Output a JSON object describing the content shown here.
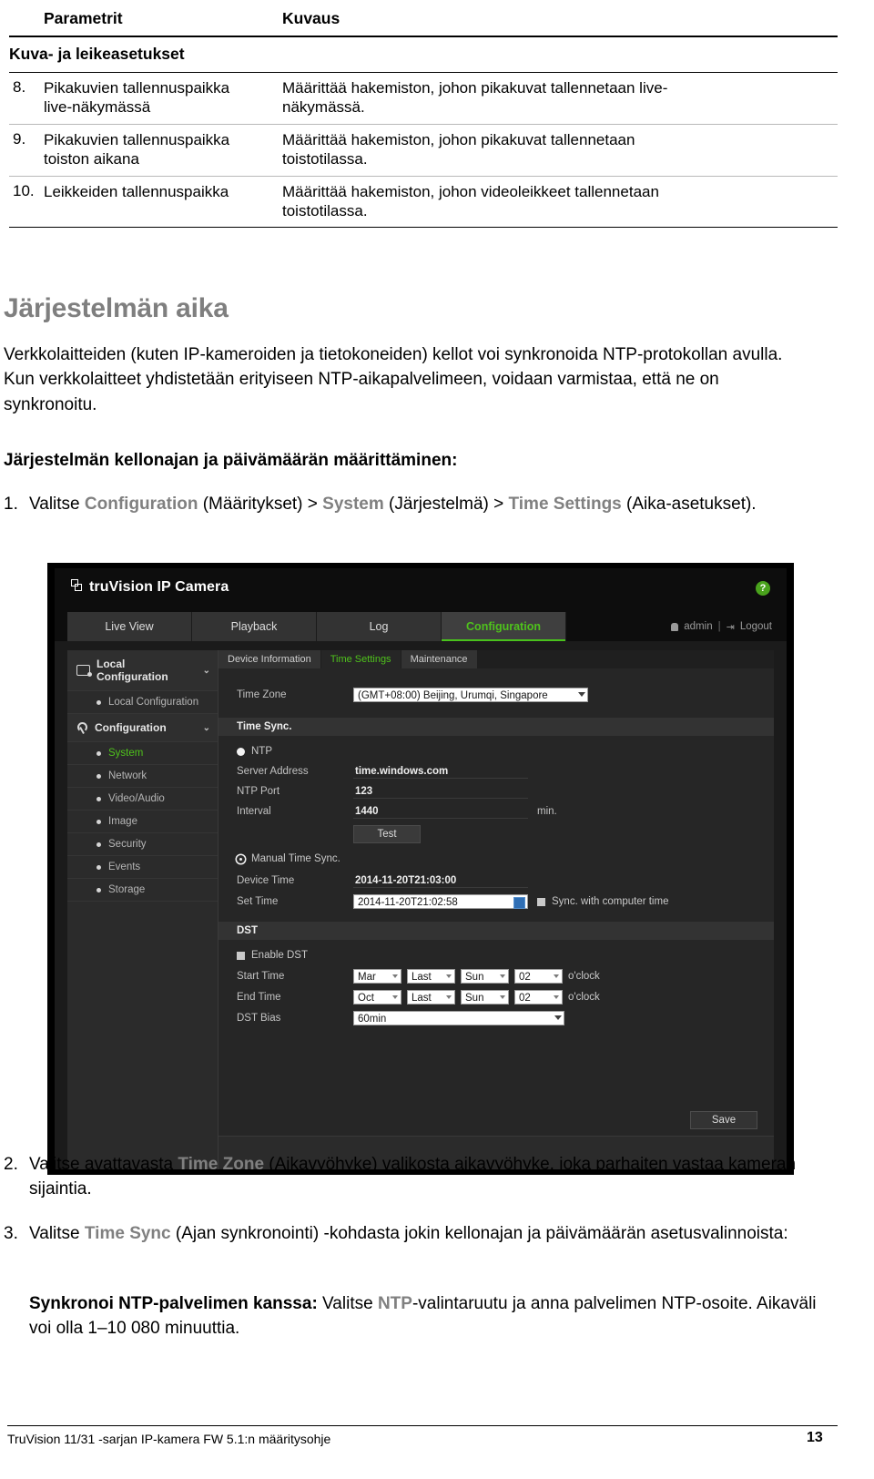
{
  "table": {
    "headers": [
      "Parametrit",
      "Kuvaus"
    ],
    "section_title": "Kuva- ja leikeasetukset",
    "rows": [
      {
        "num": "8.",
        "param_lines": [
          "Pikakuvien tallennuspaikka",
          "live-näkymässä"
        ],
        "desc_lines": [
          "Määrittää hakemiston, johon pikakuvat tallennetaan live-",
          "näkymässä."
        ]
      },
      {
        "num": "9.",
        "param_lines": [
          "Pikakuvien tallennuspaikka",
          "toiston aikana"
        ],
        "desc_lines": [
          "Määrittää hakemiston, johon pikakuvat tallennetaan",
          "toistotilassa."
        ]
      },
      {
        "num": "10.",
        "param_lines": [
          "Leikkeiden tallennuspaikka"
        ],
        "desc_lines": [
          "Määrittää hakemiston, johon videoleikkeet tallennetaan",
          "toistotilassa."
        ]
      }
    ]
  },
  "heading": "Järjestelmän aika",
  "intro_paragraph": "Verkkolaitteiden (kuten IP-kameroiden ja tietokoneiden) kellot voi synkronoida NTP-protokollan avulla. Kun verkkolaitteet yhdistetään erityiseen NTP-aikapalvelimeen, voidaan varmistaa, että ne on synkronoitu.",
  "sub_heading": "Järjestelmän kellonajan ja päivämäärän määrittäminen:",
  "steps": {
    "step1": {
      "num": "1.",
      "t1": "Valitse ",
      "ui1": "Configuration",
      "t2": " (Määritykset) > ",
      "ui2": "System",
      "t3": " (Järjestelmä) > ",
      "ui3": "Time Settings",
      "t4": " (Aika-asetukset)."
    },
    "step2": {
      "num": "2.",
      "t1": "Valitse avattavasta ",
      "ui1": "Time Zone",
      "t2": " (Aikavyöhyke) valikosta aikavyöhyke, joka parhaiten vastaa kameran sijaintia."
    },
    "step3": {
      "num": "3.",
      "t1": "Valitse ",
      "ui1": "Time Sync",
      "t2": " (Ajan synkronointi) -kohdasta jokin kellonajan ja päivämäärän asetusvalinnoista:"
    },
    "substep": {
      "bold": "Synkronoi NTP-palvelimen kanssa:",
      "t1": " Valitse ",
      "ui1": "NTP",
      "t2": "-valintaruutu ja anna palvelimen NTP-osoite. Aikaväli voi olla 1–10 080 minuuttia."
    }
  },
  "footer": {
    "left": "TruVision 11/31 -sarjan IP-kamera FW 5.1:n määritysohje",
    "page": "13"
  },
  "screenshot": {
    "brand": "truVision  IP Camera",
    "help_glyph": "?",
    "nav_tabs": [
      "Live View",
      "Playback",
      "Log",
      "Configuration"
    ],
    "active_nav_tab": "Configuration",
    "user": "admin",
    "logout": "Logout",
    "nav_separator": "|",
    "sidebar": {
      "group1": "Local Configuration",
      "group1_chevron": "⌄",
      "group1_items": [
        "Local Configuration"
      ],
      "group2": "Configuration",
      "group2_chevron": "⌄",
      "group2_items": [
        "System",
        "Network",
        "Video/Audio",
        "Image",
        "Security",
        "Events",
        "Storage"
      ],
      "selected_item": "System"
    },
    "subtabs": [
      "Device Information",
      "Time Settings",
      "Maintenance"
    ],
    "active_subtab": "Time Settings",
    "form": {
      "time_zone_label": "Time Zone",
      "time_zone_value": "(GMT+08:00) Beijing, Urumqi, Singapore",
      "time_sync_section": "Time Sync.",
      "ntp_label": "NTP",
      "server_address_label": "Server Address",
      "server_address_value": "time.windows.com",
      "ntp_port_label": "NTP Port",
      "ntp_port_value": "123",
      "interval_label": "Interval",
      "interval_value": "1440",
      "interval_unit": "min.",
      "test_button": "Test",
      "manual_time_sync_label": "Manual Time Sync.",
      "device_time_label": "Device Time",
      "device_time_value": "2014-11-20T21:03:00",
      "set_time_label": "Set Time",
      "set_time_value": "2014-11-20T21:02:58",
      "sync_computer_label": "Sync. with computer time",
      "dst_section": "DST",
      "enable_dst_label": "Enable DST",
      "start_time_label": "Start Time",
      "start_time_month": "Mar",
      "start_time_week": "Last",
      "start_time_day": "Sun",
      "start_time_hour": "02",
      "start_time_unit": "o'clock",
      "end_time_label": "End Time",
      "end_time_month": "Oct",
      "end_time_week": "Last",
      "end_time_day": "Sun",
      "end_time_hour": "02",
      "end_time_unit": "o'clock",
      "dst_bias_label": "DST Bias",
      "dst_bias_value": "60min",
      "save_button": "Save"
    }
  },
  "colors": {
    "accent_green": "#4fc21c",
    "ui_gray": "#808080",
    "heading_gray": "#7f7f7f"
  }
}
